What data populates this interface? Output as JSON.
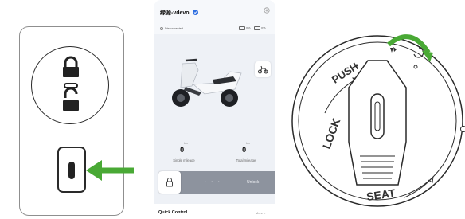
{
  "lock_panel": {
    "icons": [
      "lock-closed-icon",
      "lock-open-icon",
      "green-arrow-icon"
    ],
    "accent": "#49a935"
  },
  "phone": {
    "device_name": "绿源-vdevo",
    "connection_status": "Disconnected",
    "battery_a": "0%",
    "battery_b": "0%",
    "stats": [
      {
        "value": "0",
        "unit": "km",
        "label": "Single mileage"
      },
      {
        "value": "0",
        "unit": "km",
        "label": "Total mileage"
      }
    ],
    "unlock": {
      "dots": "• • •",
      "label": "Unlock"
    },
    "quick_control": {
      "title": "Quick Control",
      "more": "More >"
    }
  },
  "ignition": {
    "labels": {
      "push": "PUSH",
      "lock": "LOCK",
      "seat": "SEAT"
    },
    "accent": "#49a935"
  }
}
